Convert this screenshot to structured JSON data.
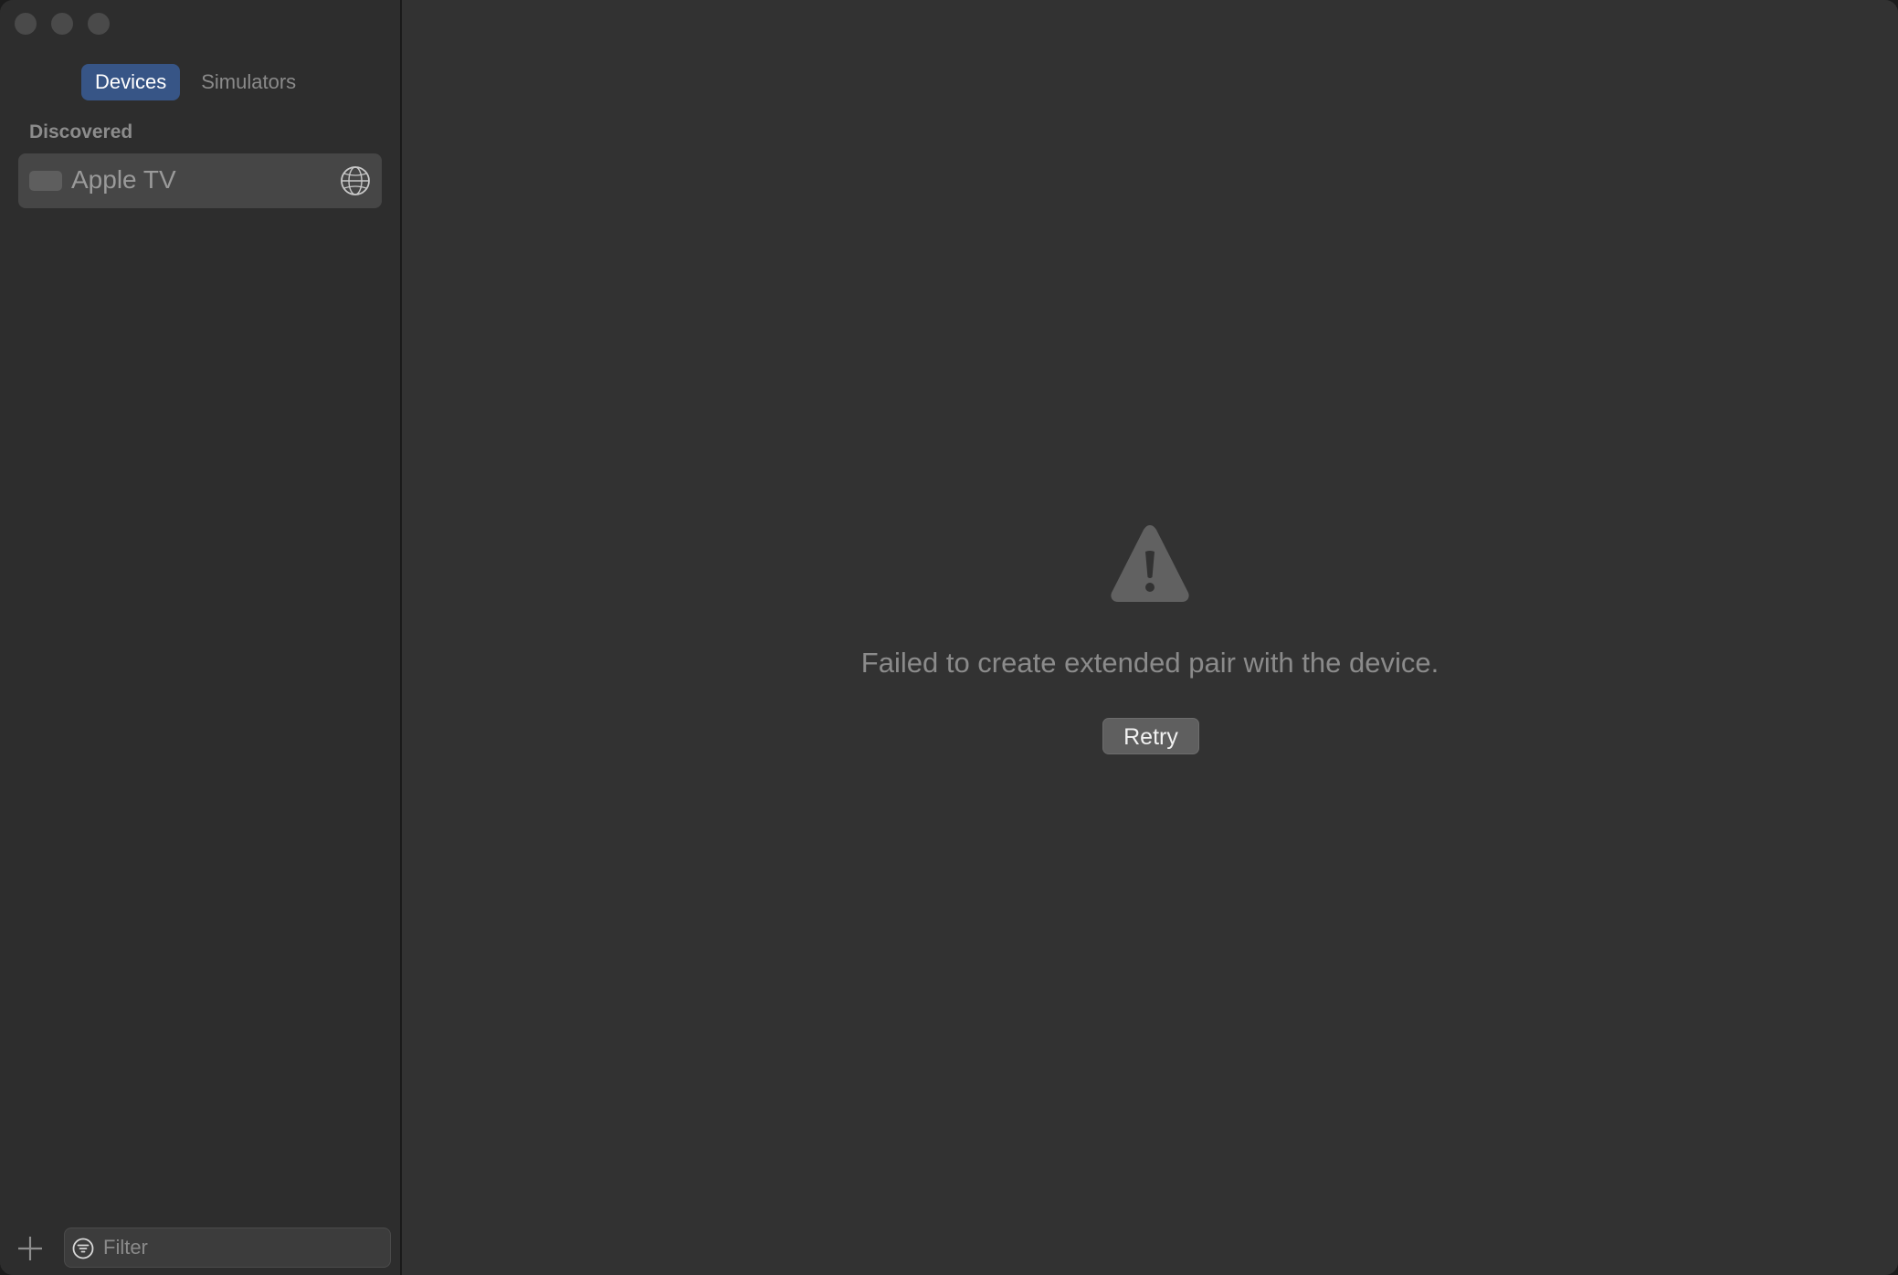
{
  "sidebar": {
    "tabs": [
      {
        "label": "Devices",
        "active": true
      },
      {
        "label": "Simulators",
        "active": false
      }
    ],
    "section_title": "Discovered",
    "devices": [
      {
        "name": "Apple TV",
        "icon": "apple-tv-icon",
        "status_icon": "globe-icon"
      }
    ],
    "filter": {
      "placeholder": "Filter",
      "value": ""
    }
  },
  "main": {
    "icon": "warning-icon",
    "message": "Failed to create extended pair with the device.",
    "retry_label": "Retry"
  },
  "colors": {
    "active_tab": "#375586",
    "window_bg": "#323232",
    "sidebar_bg": "#2d2d2d"
  }
}
